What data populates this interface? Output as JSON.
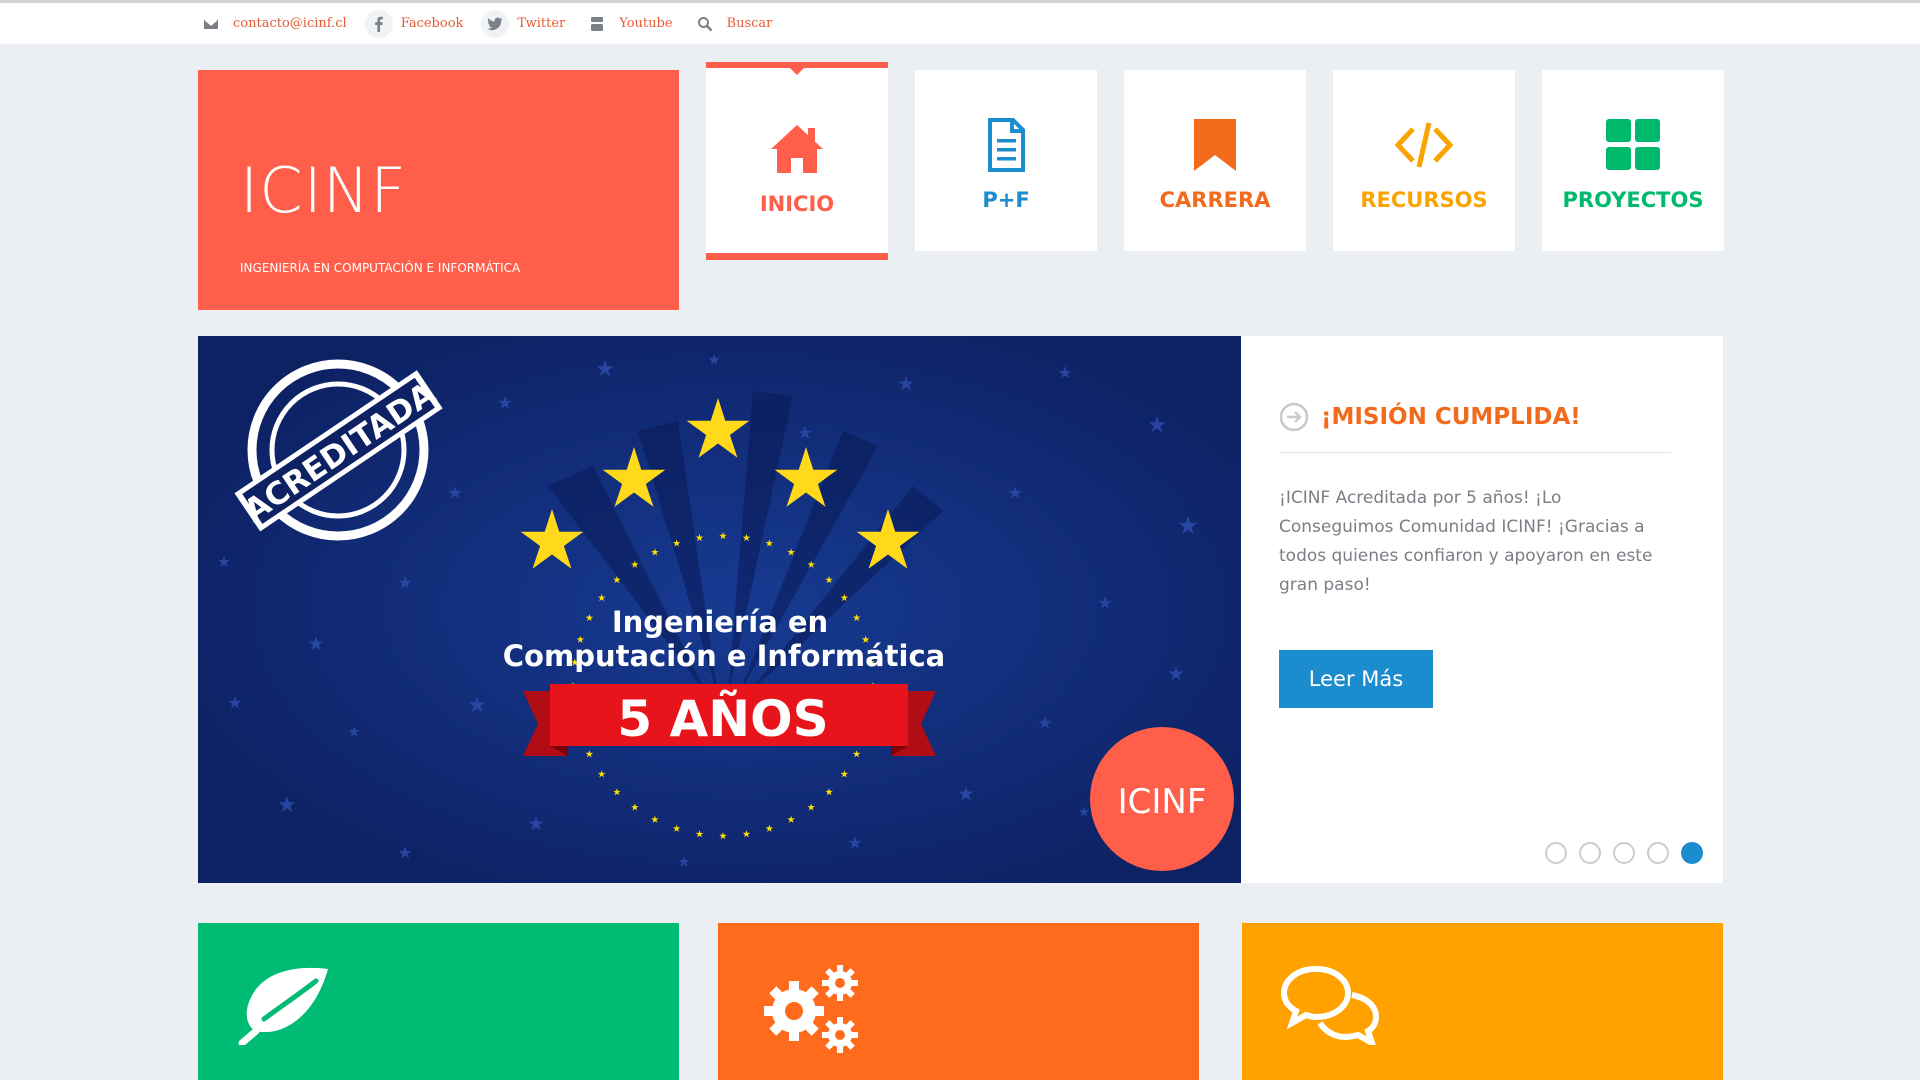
{
  "topbar": {
    "email": "contacto@icinf.cl",
    "facebook": "Facebook",
    "twitter": "Twitter",
    "youtube": "Youtube",
    "search": "Buscar"
  },
  "brand": {
    "name": "ICINF",
    "subtitle": "INGENIERÍA EN COMPUTACIÓN E INFORMÁTICA",
    "color": "#ff5e4a"
  },
  "nav": [
    {
      "label": "INICIO",
      "icon": "home-icon",
      "color": "#ff5e4a",
      "active": true
    },
    {
      "label": "P+F",
      "icon": "document-icon",
      "color": "#1b8ccd",
      "active": false
    },
    {
      "label": "CARRERA",
      "icon": "bookmark-icon",
      "color": "#f26a1b",
      "active": false
    },
    {
      "label": "RECURSOS",
      "icon": "code-icon",
      "color": "#f9a400",
      "active": false
    },
    {
      "label": "PROYECTOS",
      "icon": "grid-icon",
      "color": "#00b96d",
      "active": false
    }
  ],
  "slider": {
    "image": {
      "stamp": "ACREDITADA",
      "line1": "Ingeniería en",
      "line2": "Computación e Informática",
      "ribbon": "5 AÑOS",
      "badge": "ICINF"
    },
    "title": "¡MISIÓN CUMPLIDA!",
    "body": "¡ICINF Acreditada por 5 años! ¡Lo Conseguimos Comunidad ICINF! ¡Gracias a todos quienes confiaron y apoyaron en este gran paso!",
    "button": "Leer Más",
    "dot_count": 5,
    "active_dot": 5
  },
  "bottom_tiles": [
    {
      "icon": "leaf-icon",
      "color": "#00bb74"
    },
    {
      "icon": "gears-icon",
      "color": "#ff6b1c"
    },
    {
      "icon": "chat-icon",
      "color": "#ffa200"
    }
  ]
}
